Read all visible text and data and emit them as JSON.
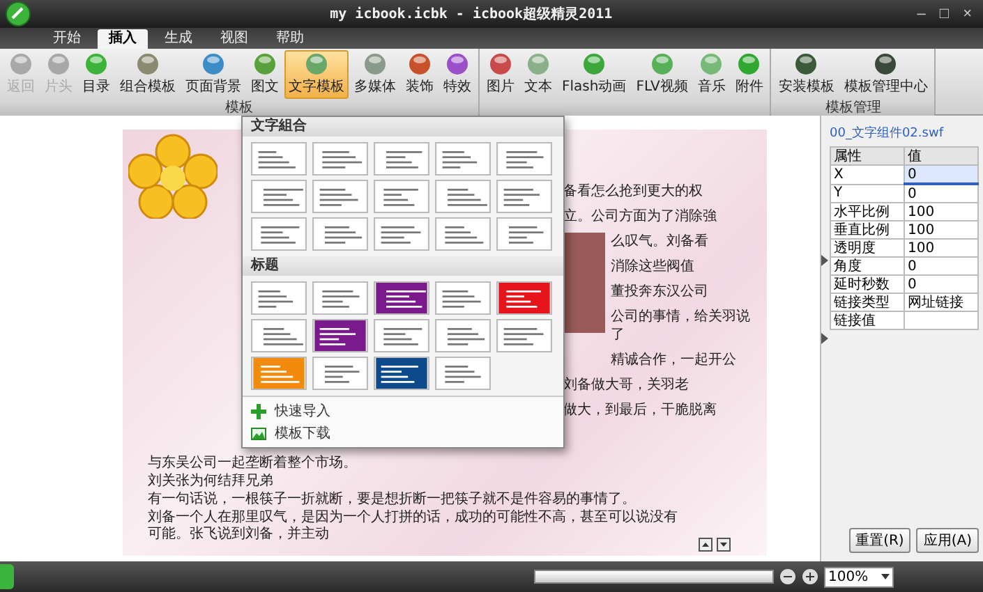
{
  "window": {
    "title": "my icbook.icbk - icbook超级精灵2011",
    "controls": [
      "–",
      "□",
      "×"
    ]
  },
  "tabs": [
    {
      "label": "开始",
      "selected": false
    },
    {
      "label": "插入",
      "selected": true
    },
    {
      "label": "生成",
      "selected": false
    },
    {
      "label": "视图",
      "selected": false
    },
    {
      "label": "帮助",
      "selected": false
    }
  ],
  "ribbon": {
    "groups": [
      {
        "label": "模板",
        "buttons": [
          {
            "label": "返回",
            "color": "#a8a8a8",
            "disabled": true,
            "selected": false
          },
          {
            "label": "片头",
            "color": "#a8a8a8",
            "disabled": true,
            "selected": false
          },
          {
            "label": "目录",
            "color": "#3cb43c",
            "disabled": false,
            "selected": false
          },
          {
            "label": "组合模板",
            "color": "#8a8a70",
            "disabled": false,
            "selected": false
          },
          {
            "label": "页面背景",
            "color": "#3c8cc8",
            "disabled": false,
            "selected": false
          },
          {
            "label": "图文",
            "color": "#5aa03c",
            "disabled": false,
            "selected": false
          },
          {
            "label": "文字模板",
            "color": "#6aa86a",
            "disabled": false,
            "selected": true
          },
          {
            "label": "多媒体",
            "color": "#8a9a8a",
            "disabled": false,
            "selected": false
          },
          {
            "label": "装饰",
            "color": "#c8502a",
            "disabled": false,
            "selected": false
          },
          {
            "label": "特效",
            "color": "#9a50c8",
            "disabled": false,
            "selected": false
          }
        ]
      },
      {
        "buttons": [
          {
            "label": "图片",
            "color": "#c84a4a",
            "disabled": false,
            "selected": false
          },
          {
            "label": "文本",
            "color": "#8ab08a",
            "disabled": false,
            "selected": false
          },
          {
            "label": "Flash动画",
            "color": "#3ca83c",
            "disabled": false,
            "selected": false
          },
          {
            "label": "FLV视频",
            "color": "#58b058",
            "disabled": false,
            "selected": false
          },
          {
            "label": "音乐",
            "color": "#78b878",
            "disabled": false,
            "selected": false
          },
          {
            "label": "附件",
            "color": "#2ea82e",
            "disabled": false,
            "selected": false
          }
        ]
      },
      {
        "label": "模板管理",
        "buttons": [
          {
            "label": "安装模板",
            "color": "#3a5a3a",
            "disabled": false,
            "selected": false
          },
          {
            "label": "模板管理中心",
            "color": "#3a4a3a",
            "disabled": false,
            "selected": false
          }
        ]
      }
    ]
  },
  "template_menu": {
    "sections": [
      {
        "title": "文字組合",
        "thumbnails": [
          {
            "color": "#ffffff"
          },
          {
            "color": "#ffffff"
          },
          {
            "color": "#ffffff"
          },
          {
            "color": "#ffffff"
          },
          {
            "color": "#ffffff"
          },
          {
            "color": "#ffffff"
          },
          {
            "color": "#ffffff"
          },
          {
            "color": "#ffffff"
          },
          {
            "color": "#ffffff"
          },
          {
            "color": "#ffffff"
          },
          {
            "color": "#ffffff"
          },
          {
            "color": "#ffffff"
          },
          {
            "color": "#ffffff"
          },
          {
            "color": "#ffffff"
          },
          {
            "color": "#ffffff"
          }
        ]
      },
      {
        "title": "标题",
        "thumbnails": [
          {
            "color": "#ffffff"
          },
          {
            "color": "#ffffff"
          },
          {
            "color": "#7b1a8c"
          },
          {
            "color": "#ffffff"
          },
          {
            "color": "#e8141b"
          },
          {
            "color": "#ffffff"
          },
          {
            "color": "#7b1a8c"
          },
          {
            "color": "#ffffff"
          },
          {
            "color": "#ffffff"
          },
          {
            "color": "#ffffff"
          },
          {
            "color": "#f28a0c"
          },
          {
            "color": "#ffffff"
          },
          {
            "color": "#0d4a8c"
          },
          {
            "color": "#ffffff"
          }
        ]
      }
    ],
    "actions": [
      {
        "kind": "import",
        "label": "快速导入"
      },
      {
        "kind": "download",
        "label": "模板下载"
      }
    ]
  },
  "document": {
    "lines": [
      {
        "kind": "right",
        "text": "备看怎么抢到更大的权"
      },
      {
        "kind": "right",
        "text": "立。公司方面为了消除強"
      },
      {
        "kind": "right",
        "text": "么叹气。刘备看"
      },
      {
        "kind": "right",
        "text": "消除这些阀值"
      },
      {
        "kind": "right",
        "text": "董投奔东汉公司"
      },
      {
        "kind": "right",
        "text": "公司的事情，给关羽说了"
      },
      {
        "kind": "right",
        "text": "精诚合作，一起开公"
      },
      {
        "kind": "right",
        "text": "刘备做大哥，关羽老"
      },
      {
        "kind": "right",
        "text": "做大，到最后，干脆脱离"
      },
      {
        "kind": "full",
        "text": "与东吴公司一起垄断着整个市场。"
      },
      {
        "kind": "full",
        "text": "刘关张为何结拜兄弟"
      },
      {
        "kind": "full",
        "text": "有一句话说，一根筷子一折就断，要是想折断一把筷子就不是件容易的事情了。"
      },
      {
        "kind": "full",
        "text": "刘备一个人在那里叹气，是因为一个人打拼的话，成功的可能性不高，甚至可以说没有可能。张飞说到刘备，并主动"
      }
    ]
  },
  "properties": {
    "file": "00_文字组件02.swf",
    "columns": [
      "属性",
      "值"
    ],
    "rows": [
      {
        "name": "X",
        "value": "0",
        "selected": true
      },
      {
        "name": "Y",
        "value": "0",
        "selected": false
      },
      {
        "name": "水平比例",
        "value": "100",
        "selected": false
      },
      {
        "name": "垂直比例",
        "value": "100",
        "selected": false
      },
      {
        "name": "透明度",
        "value": "100",
        "selected": false
      },
      {
        "name": "角度",
        "value": "0",
        "selected": false
      },
      {
        "name": "延时秒数",
        "value": "0",
        "selected": false
      },
      {
        "name": "链接类型",
        "value": "网址链接",
        "selected": false
      },
      {
        "name": "链接值",
        "value": "",
        "selected": false
      }
    ],
    "buttons": [
      "重置(R)",
      "应用(A)"
    ]
  },
  "status_bar": {
    "zoom": "100%"
  }
}
